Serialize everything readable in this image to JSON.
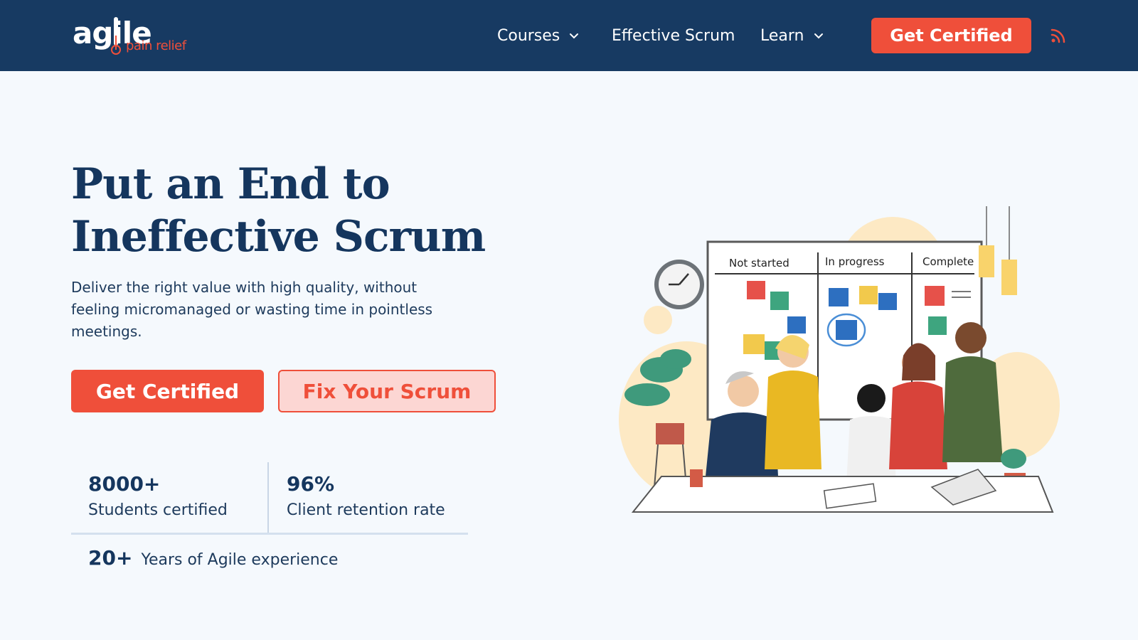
{
  "brand": {
    "logo_word": "agile",
    "logo_sub": "pain relief",
    "accent_color": "#ef4f3a",
    "nav_bg": "#173a62"
  },
  "nav": {
    "courses": "Courses",
    "effective_scrum": "Effective Scrum",
    "learn": "Learn",
    "cta": "Get Certified",
    "rss_icon": "rss-icon"
  },
  "hero": {
    "headline_line1": "Put an End to",
    "headline_line2": "Ineffective Scrum",
    "subtext": "Deliver the right value with high quality, without feeling micromanaged or wasting time in pointless meetings.",
    "primary_button": "Get Certified",
    "secondary_button": "Fix Your Scrum"
  },
  "stats": [
    {
      "value": "8000+",
      "label": "Students certified"
    },
    {
      "value": "96%",
      "label": "Client retention rate"
    },
    {
      "value": "20+",
      "label": "Years of Agile experience"
    }
  ],
  "illustration": {
    "board_columns": [
      "Not started",
      "In progress",
      "Complete"
    ]
  }
}
